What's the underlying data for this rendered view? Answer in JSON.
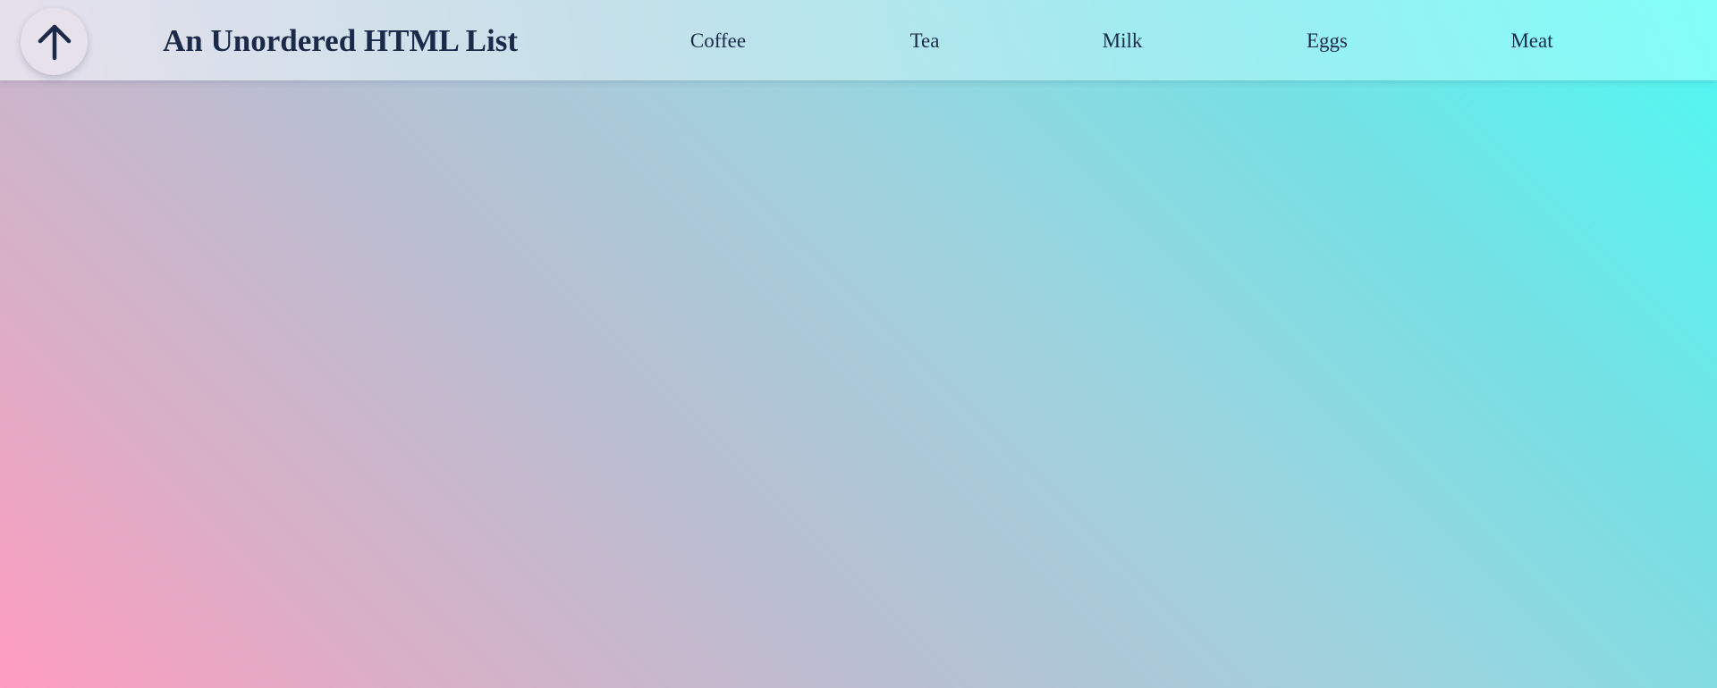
{
  "header": {
    "title": "An Unordered HTML List",
    "scroll_top_icon": "arrow-up-icon",
    "nav_items": [
      "Coffee",
      "Tea",
      "Milk",
      "Eggs",
      "Meat"
    ]
  },
  "colors": {
    "text": "#1b2a4a",
    "gradient_bottom_left": "#ff9cbf",
    "gradient_top_right": "#4ffaf3",
    "header_bg": "#e0f4f6",
    "button_bg": "#e6e1ea"
  }
}
